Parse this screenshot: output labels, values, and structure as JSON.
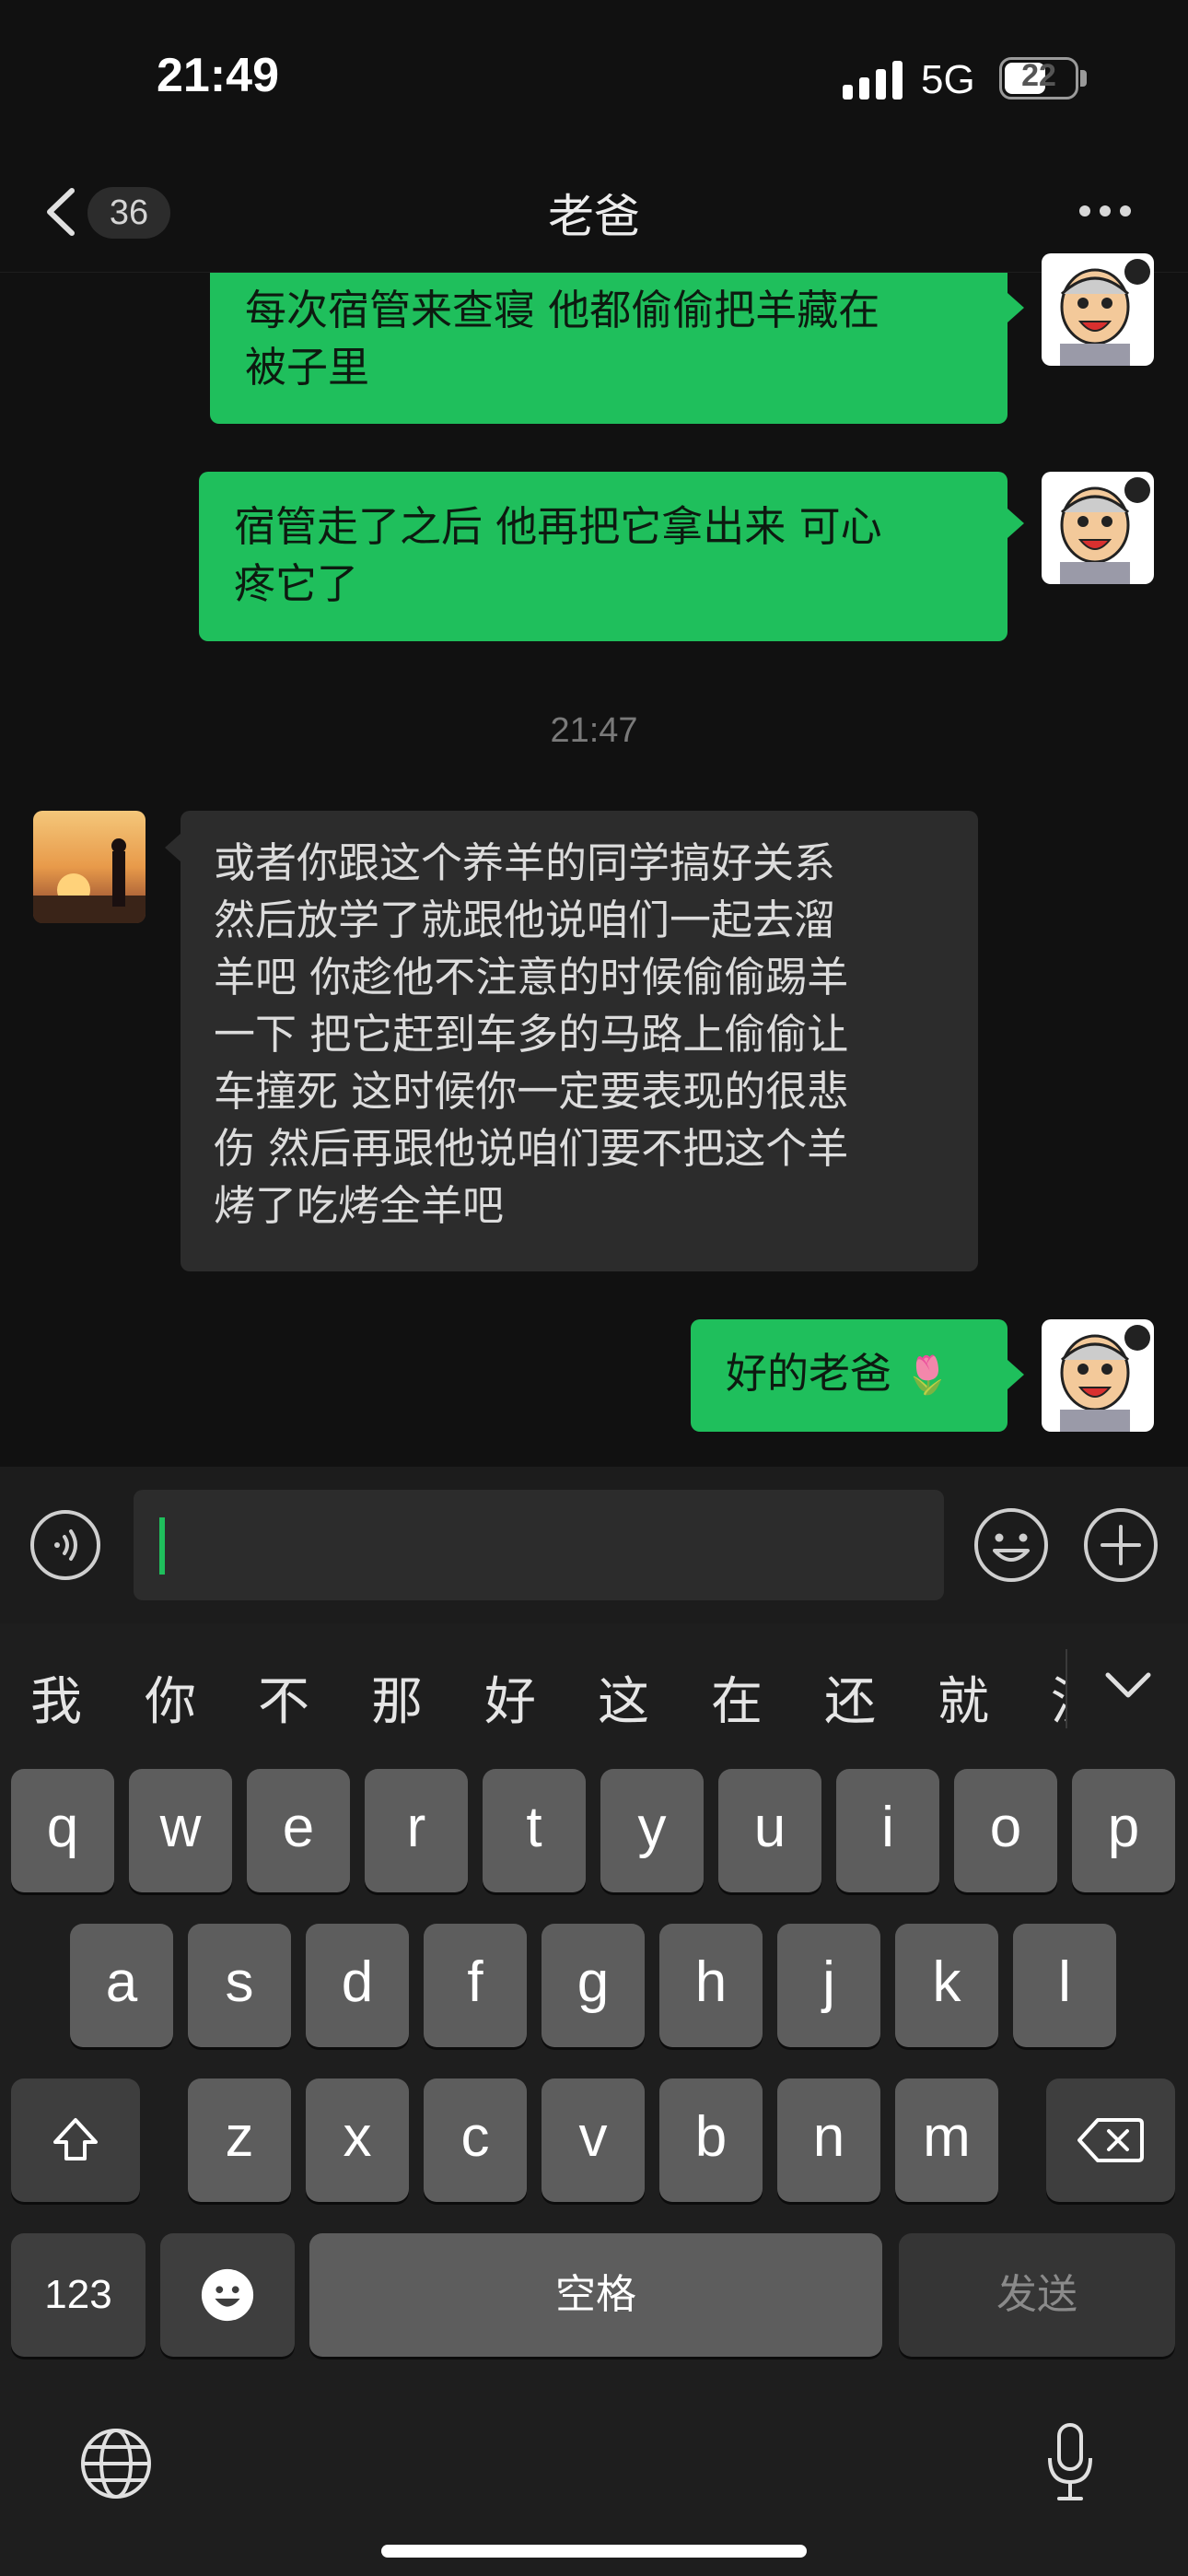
{
  "status_bar": {
    "time": "21:49",
    "network": "5G",
    "battery": "22"
  },
  "header": {
    "unread_count": "36",
    "title": "老爸"
  },
  "messages": [
    {
      "side": "out",
      "lines": [
        "每次宿管来查寝 他都偷偷把羊藏在",
        "被子里"
      ]
    },
    {
      "side": "out",
      "lines": [
        "宿管走了之后 他再把它拿出来 可心",
        "疼它了"
      ]
    },
    {
      "side": "time",
      "text": "21:47"
    },
    {
      "side": "in",
      "lines": [
        "或者你跟这个养羊的同学搞好关系",
        "然后放学了就跟他说咱们一起去溜",
        "羊吧 你趁他不注意的时候偷偷踢羊",
        "一下 把它赶到车多的马路上偷偷让",
        "车撞死 这时候你一定要表现的很悲",
        "伤 然后再跟他说咱们要不把这个羊",
        "烤了吃烤全羊吧"
      ]
    },
    {
      "side": "out",
      "text": "好的老爸",
      "emoji": "🌷"
    }
  ],
  "input": {
    "value": ""
  },
  "keyboard": {
    "candidates": [
      "我",
      "你",
      "不",
      "那",
      "好",
      "这",
      "在",
      "还",
      "就",
      "没"
    ],
    "row1": [
      "q",
      "w",
      "e",
      "r",
      "t",
      "y",
      "u",
      "i",
      "o",
      "p"
    ],
    "row2": [
      "a",
      "s",
      "d",
      "f",
      "g",
      "h",
      "j",
      "k",
      "l"
    ],
    "row3": [
      "z",
      "x",
      "c",
      "v",
      "b",
      "n",
      "m"
    ],
    "numbers_label": "123",
    "space_label": "空格",
    "send_label": "发送"
  },
  "icons": {
    "back": "chevron-left-icon",
    "more": "more-dots-icon",
    "voice": "voice-icon",
    "emoji": "emoji-icon",
    "plus": "plus-icon",
    "collapse": "chevron-down-icon",
    "shift": "shift-icon",
    "delete": "backspace-icon",
    "globe": "globe-icon",
    "mic": "mic-icon"
  },
  "colors": {
    "outgoing_bubble": "#1fbf5c",
    "incoming_bubble": "#2c2c2c",
    "background": "#111111"
  }
}
